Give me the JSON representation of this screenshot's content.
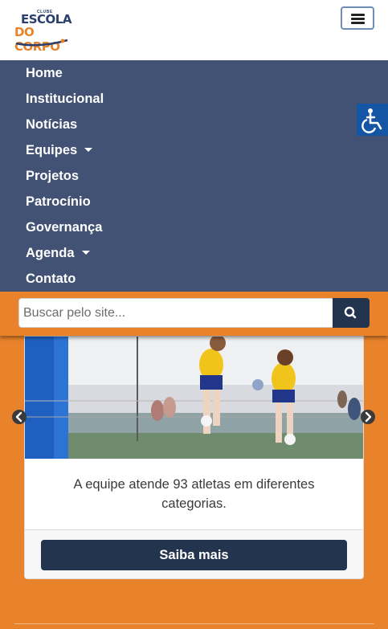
{
  "header": {
    "logo": {
      "small": "CLUBE",
      "line1": "ESCOLA",
      "line2": "DO CORPO"
    },
    "menu_toggle_icon": "hamburger-icon"
  },
  "nav": {
    "items": [
      {
        "label": "Home",
        "dropdown": false
      },
      {
        "label": "Institucional",
        "dropdown": false
      },
      {
        "label": "Notícias",
        "dropdown": false
      },
      {
        "label": "Equipes",
        "dropdown": true
      },
      {
        "label": "Projetos",
        "dropdown": false
      },
      {
        "label": "Patrocínio",
        "dropdown": false
      },
      {
        "label": "Governança",
        "dropdown": false
      },
      {
        "label": "Agenda",
        "dropdown": true
      },
      {
        "label": "Contato",
        "dropdown": false
      }
    ]
  },
  "accessibility": {
    "icon": "wheelchair-accessibility-icon"
  },
  "search": {
    "placeholder": "Buscar pelo site...",
    "value": "",
    "icon": "search-icon"
  },
  "carousel": {
    "prev_icon": "chevron-left-icon",
    "next_icon": "chevron-right-icon",
    "card": {
      "image": "volleyball-players-photo",
      "text": "A equipe atende 93 atletas em diferentes categorias.",
      "button_label": "Saiba mais"
    }
  },
  "colors": {
    "brand_orange": "#e8832b",
    "nav_blue": "#415274",
    "dark_navy": "#23344f",
    "accessibility_blue": "#1455a6"
  }
}
